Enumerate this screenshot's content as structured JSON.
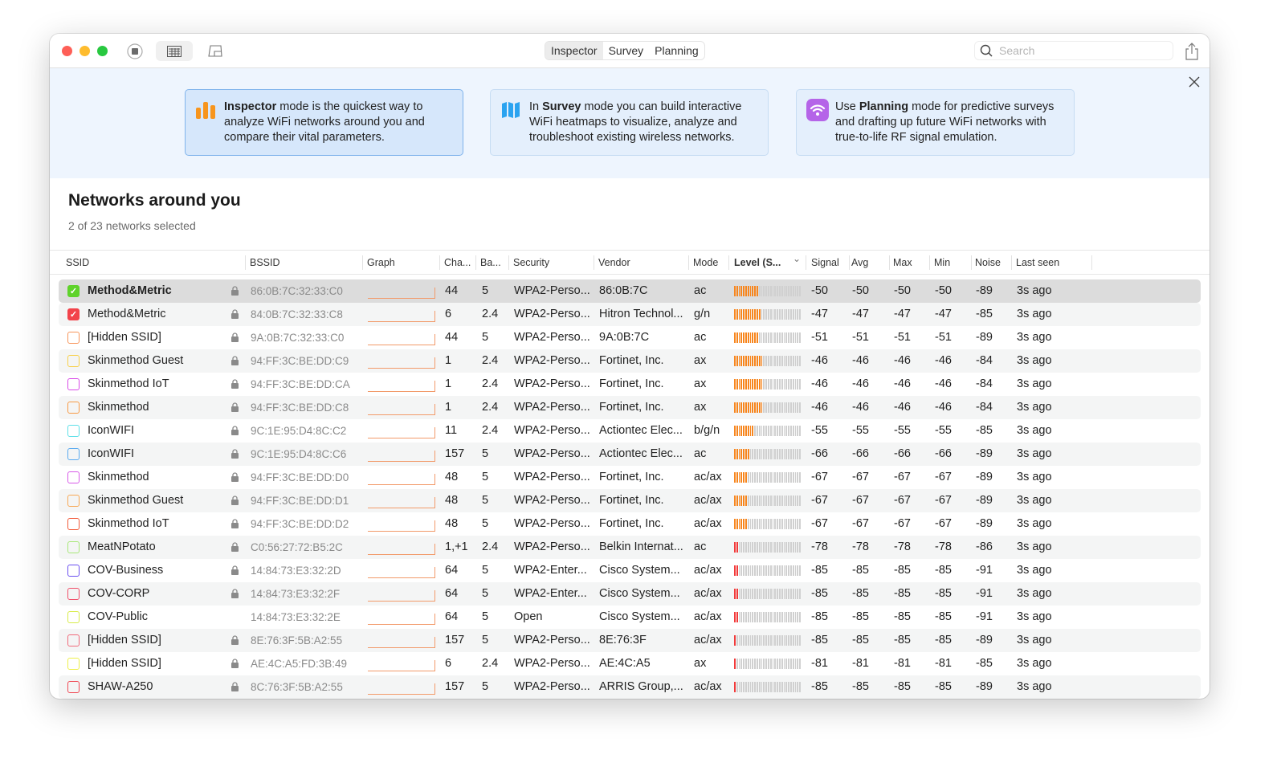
{
  "toolbar": {
    "modes": [
      "Inspector",
      "Survey",
      "Planning"
    ],
    "active_mode": "Inspector",
    "search_placeholder": "Search"
  },
  "banner": {
    "cards": [
      {
        "bold": "Inspector",
        "pre": "",
        "text": " mode is the quickest way to analyze WiFi networks around you and compare their vital parameters.",
        "icon": "bar-chart-icon",
        "color": "#f7951d"
      },
      {
        "bold": "Survey",
        "pre": "In ",
        "text": " mode you can build interactive WiFi heatmaps to visualize, analyze and troubleshoot existing wireless networks.",
        "icon": "map-icon",
        "color": "#2aa3f0"
      },
      {
        "bold": "Planning",
        "pre": "Use ",
        "text": " mode for predictive surveys and drafting up future WiFi networks with true-to-life RF signal emulation.",
        "icon": "wifi-icon",
        "color": "#b564e8"
      }
    ]
  },
  "main": {
    "title": "Networks around you",
    "subtitle": "2 of 23 networks selected"
  },
  "columns": [
    "SSID",
    "BSSID",
    "Graph",
    "Cha...",
    "Ba...",
    "Security",
    "Vendor",
    "Mode",
    "Level (S...",
    "Signal",
    "Avg",
    "Max",
    "Min",
    "Noise",
    "Last seen"
  ],
  "rows": [
    {
      "ssid": "Method&Metric",
      "checked": true,
      "color": "#5fd32b",
      "lock": true,
      "bssid": "86:0B:7C:32:33:C0",
      "ch": "44",
      "band": "5",
      "sec": "WPA2-Perso...",
      "vendor": "86:0B:7C",
      "mode": "ac",
      "bars": 11,
      "signal": "-50",
      "avg": "-50",
      "max": "-50",
      "min": "-50",
      "noise": "-89",
      "seen": "3s ago"
    },
    {
      "ssid": "Method&Metric",
      "checked": true,
      "color": "#f2434b",
      "lock": true,
      "bssid": "84:0B:7C:32:33:C8",
      "ch": "6",
      "band": "2.4",
      "sec": "WPA2-Perso...",
      "vendor": "Hitron Technol...",
      "mode": "g/n",
      "bars": 12,
      "signal": "-47",
      "avg": "-47",
      "max": "-47",
      "min": "-47",
      "noise": "-85",
      "seen": "3s ago"
    },
    {
      "ssid": "[Hidden SSID]",
      "checked": false,
      "color": "#f7955a",
      "lock": true,
      "bssid": "9A:0B:7C:32:33:C0",
      "ch": "44",
      "band": "5",
      "sec": "WPA2-Perso...",
      "vendor": "9A:0B:7C",
      "mode": "ac",
      "bars": 11,
      "signal": "-51",
      "avg": "-51",
      "max": "-51",
      "min": "-51",
      "noise": "-89",
      "seen": "3s ago"
    },
    {
      "ssid": "Skinmethod Guest",
      "checked": false,
      "color": "#f7d04a",
      "lock": true,
      "bssid": "94:FF:3C:BE:DD:C9",
      "ch": "1",
      "band": "2.4",
      "sec": "WPA2-Perso...",
      "vendor": "Fortinet, Inc.",
      "mode": "ax",
      "bars": 13,
      "signal": "-46",
      "avg": "-46",
      "max": "-46",
      "min": "-46",
      "noise": "-84",
      "seen": "3s ago"
    },
    {
      "ssid": "Skinmethod IoT",
      "checked": false,
      "color": "#d94be8",
      "lock": true,
      "bssid": "94:FF:3C:BE:DD:CA",
      "ch": "1",
      "band": "2.4",
      "sec": "WPA2-Perso...",
      "vendor": "Fortinet, Inc.",
      "mode": "ax",
      "bars": 13,
      "signal": "-46",
      "avg": "-46",
      "max": "-46",
      "min": "-46",
      "noise": "-84",
      "seen": "3s ago"
    },
    {
      "ssid": "Skinmethod",
      "checked": false,
      "color": "#f79a45",
      "lock": true,
      "bssid": "94:FF:3C:BE:DD:C8",
      "ch": "1",
      "band": "2.4",
      "sec": "WPA2-Perso...",
      "vendor": "Fortinet, Inc.",
      "mode": "ax",
      "bars": 13,
      "signal": "-46",
      "avg": "-46",
      "max": "-46",
      "min": "-46",
      "noise": "-84",
      "seen": "3s ago"
    },
    {
      "ssid": "IconWIFI",
      "checked": false,
      "color": "#5fe0e8",
      "lock": true,
      "bssid": "9C:1E:95:D4:8C:C2",
      "ch": "11",
      "band": "2.4",
      "sec": "WPA2-Perso...",
      "vendor": "Actiontec Elec...",
      "mode": "b/g/n",
      "bars": 9,
      "signal": "-55",
      "avg": "-55",
      "max": "-55",
      "min": "-55",
      "noise": "-85",
      "seen": "3s ago"
    },
    {
      "ssid": "IconWIFI",
      "checked": false,
      "color": "#5aaaf0",
      "lock": true,
      "bssid": "9C:1E:95:D4:8C:C6",
      "ch": "157",
      "band": "5",
      "sec": "WPA2-Perso...",
      "vendor": "Actiontec Elec...",
      "mode": "ac",
      "bars": 7,
      "signal": "-66",
      "avg": "-66",
      "max": "-66",
      "min": "-66",
      "noise": "-89",
      "seen": "3s ago"
    },
    {
      "ssid": "Skinmethod",
      "checked": false,
      "color": "#d85ae8",
      "lock": true,
      "bssid": "94:FF:3C:BE:DD:D0",
      "ch": "48",
      "band": "5",
      "sec": "WPA2-Perso...",
      "vendor": "Fortinet, Inc.",
      "mode": "ac/ax",
      "bars": 6,
      "signal": "-67",
      "avg": "-67",
      "max": "-67",
      "min": "-67",
      "noise": "-89",
      "seen": "3s ago"
    },
    {
      "ssid": "Skinmethod Guest",
      "checked": false,
      "color": "#f7a855",
      "lock": true,
      "bssid": "94:FF:3C:BE:DD:D1",
      "ch": "48",
      "band": "5",
      "sec": "WPA2-Perso...",
      "vendor": "Fortinet, Inc.",
      "mode": "ac/ax",
      "bars": 6,
      "signal": "-67",
      "avg": "-67",
      "max": "-67",
      "min": "-67",
      "noise": "-89",
      "seen": "3s ago"
    },
    {
      "ssid": "Skinmethod IoT",
      "checked": false,
      "color": "#f25a3a",
      "lock": true,
      "bssid": "94:FF:3C:BE:DD:D2",
      "ch": "48",
      "band": "5",
      "sec": "WPA2-Perso...",
      "vendor": "Fortinet, Inc.",
      "mode": "ac/ax",
      "bars": 6,
      "signal": "-67",
      "avg": "-67",
      "max": "-67",
      "min": "-67",
      "noise": "-89",
      "seen": "3s ago"
    },
    {
      "ssid": "MeatNPotato",
      "checked": false,
      "color": "#a8e878",
      "lock": true,
      "bssid": "C0:56:27:72:B5:2C",
      "ch": "1,+1",
      "band": "2.4",
      "sec": "WPA2-Perso...",
      "vendor": "Belkin Internat...",
      "mode": "ac",
      "bars": 2,
      "signal": "-78",
      "avg": "-78",
      "max": "-78",
      "min": "-78",
      "noise": "-86",
      "seen": "3s ago"
    },
    {
      "ssid": "COV-Business",
      "checked": false,
      "color": "#6a4ff0",
      "lock": true,
      "bssid": "14:84:73:E3:32:2D",
      "ch": "64",
      "band": "5",
      "sec": "WPA2-Enter...",
      "vendor": "Cisco System...",
      "mode": "ac/ax",
      "bars": 2,
      "signal": "-85",
      "avg": "-85",
      "max": "-85",
      "min": "-85",
      "noise": "-91",
      "seen": "3s ago"
    },
    {
      "ssid": "COV-CORP",
      "checked": false,
      "color": "#f0506a",
      "lock": true,
      "bssid": "14:84:73:E3:32:2F",
      "ch": "64",
      "band": "5",
      "sec": "WPA2-Enter...",
      "vendor": "Cisco System...",
      "mode": "ac/ax",
      "bars": 2,
      "signal": "-85",
      "avg": "-85",
      "max": "-85",
      "min": "-85",
      "noise": "-91",
      "seen": "3s ago"
    },
    {
      "ssid": "COV-Public",
      "checked": false,
      "color": "#d8ec4a",
      "lock": false,
      "bssid": "14:84:73:E3:32:2E",
      "ch": "64",
      "band": "5",
      "sec": "Open",
      "vendor": "Cisco System...",
      "mode": "ac/ax",
      "bars": 2,
      "signal": "-85",
      "avg": "-85",
      "max": "-85",
      "min": "-85",
      "noise": "-91",
      "seen": "3s ago"
    },
    {
      "ssid": "[Hidden SSID]",
      "checked": false,
      "color": "#f06a7a",
      "lock": true,
      "bssid": "8E:76:3F:5B:A2:55",
      "ch": "157",
      "band": "5",
      "sec": "WPA2-Perso...",
      "vendor": "8E:76:3F",
      "mode": "ac/ax",
      "bars": 1,
      "signal": "-85",
      "avg": "-85",
      "max": "-85",
      "min": "-85",
      "noise": "-89",
      "seen": "3s ago"
    },
    {
      "ssid": "[Hidden SSID]",
      "checked": false,
      "color": "#eef04a",
      "lock": true,
      "bssid": "AE:4C:A5:FD:3B:49",
      "ch": "6",
      "band": "2.4",
      "sec": "WPA2-Perso...",
      "vendor": "AE:4C:A5",
      "mode": "ax",
      "bars": 1,
      "signal": "-81",
      "avg": "-81",
      "max": "-81",
      "min": "-81",
      "noise": "-85",
      "seen": "3s ago"
    },
    {
      "ssid": "SHAW-A250",
      "checked": false,
      "color": "#f04a55",
      "lock": true,
      "bssid": "8C:76:3F:5B:A2:55",
      "ch": "157",
      "band": "5",
      "sec": "WPA2-Perso...",
      "vendor": "ARRIS Group,...",
      "mode": "ac/ax",
      "bars": 1,
      "signal": "-85",
      "avg": "-85",
      "max": "-85",
      "min": "-85",
      "noise": "-89",
      "seen": "3s ago"
    }
  ]
}
